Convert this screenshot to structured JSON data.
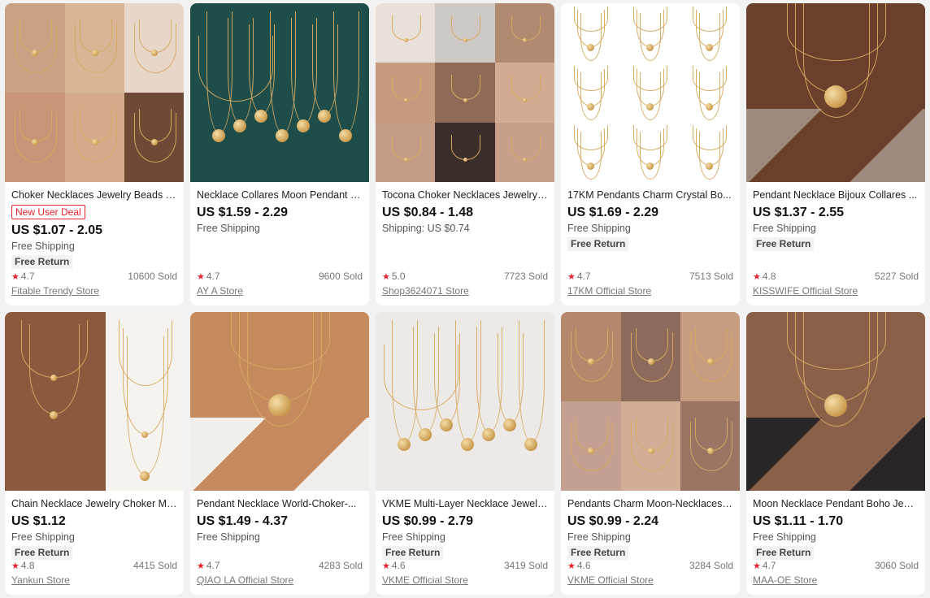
{
  "products": [
    {
      "title": "Choker Necklaces Jewelry Beads St...",
      "badge": "New User Deal",
      "price": "US $1.07 - 2.05",
      "shipping": "Free Shipping",
      "free_return": "Free Return",
      "rating": "4.7",
      "sold": "10600 Sold",
      "store": "Fitable Trendy Store"
    },
    {
      "title": "Necklace Collares Moon Pendant C...",
      "badge": "",
      "price": "US $1.59 - 2.29",
      "shipping": "Free Shipping",
      "free_return": "",
      "rating": "4.7",
      "sold": "9600 Sold",
      "store": "AY A Store"
    },
    {
      "title": "Tocona Choker Necklaces Jewelry ...",
      "badge": "",
      "price": "US $0.84 - 1.48",
      "shipping": "Shipping: US $0.74",
      "free_return": "",
      "rating": "5.0",
      "sold": "7723 Sold",
      "store": "Shop3624071 Store"
    },
    {
      "title": "17KM Pendants Charm Crystal Bo...",
      "badge": "",
      "price": "US $1.69 - 2.29",
      "shipping": "Free Shipping",
      "free_return": "Free Return",
      "rating": "4.7",
      "sold": "7513 Sold",
      "store": "17KM Official Store"
    },
    {
      "title": "Pendant Necklace Bijoux Collares ...",
      "badge": "",
      "price": "US $1.37 - 2.55",
      "shipping": "Free Shipping",
      "free_return": "Free Return",
      "rating": "4.8",
      "sold": "5227 Sold",
      "store": "KISSWIFE Official Store"
    },
    {
      "title": "Chain Necklace Jewelry Choker Mo...",
      "badge": "",
      "price": "US $1.12",
      "shipping": "Free Shipping",
      "free_return": "Free Return",
      "rating": "4.8",
      "sold": "4415 Sold",
      "store": "Yankun Store"
    },
    {
      "title": "Pendant Necklace World-Choker-...",
      "badge": "",
      "price": "US $1.49 - 4.37",
      "shipping": "Free Shipping",
      "free_return": "",
      "rating": "4.7",
      "sold": "4283 Sold",
      "store": "QIAO LA Official Store"
    },
    {
      "title": "VKME Multi-Layer Necklace Jewelle...",
      "badge": "",
      "price": "US $0.99 - 2.79",
      "shipping": "Free Shipping",
      "free_return": "Free Return",
      "rating": "4.6",
      "sold": "3419 Sold",
      "store": "VKME Official Store"
    },
    {
      "title": "Pendants Charm Moon-Necklaces ...",
      "badge": "",
      "price": "US $0.99 - 2.24",
      "shipping": "Free Shipping",
      "free_return": "Free Return",
      "rating": "4.6",
      "sold": "3284 Sold",
      "store": "VKME Official Store"
    },
    {
      "title": "Moon Necklace Pendant Boho Jew...",
      "badge": "",
      "price": "US $1.11 - 1.70",
      "shipping": "Free Shipping",
      "free_return": "Free Return",
      "rating": "4.7",
      "sold": "3060 Sold",
      "store": "MAA-OE Store"
    }
  ],
  "images": [
    {
      "kind": "collage6",
      "tones": [
        "#c9a184",
        "#d8b595",
        "#e8d6c8",
        "#c89578",
        "#d6ab8c",
        "#6e4a36"
      ]
    },
    {
      "kind": "flatlay",
      "tones": [
        "#1f4e4a"
      ]
    },
    {
      "kind": "collage9",
      "tones": [
        "#e9e0da",
        "#cfc9c6",
        "#b18a72",
        "#c59a7e",
        "#8e6a57",
        "#d2ac92",
        "#c49d86",
        "#3a2e2a",
        "#c6a08a"
      ]
    },
    {
      "kind": "product4x3",
      "tones": [
        "#ffffff"
      ]
    },
    {
      "kind": "model",
      "tones": [
        "#6a3f2b",
        "#9e8a7c"
      ]
    },
    {
      "kind": "split2",
      "tones": [
        "#8a5a3e",
        "#f6f3ef"
      ]
    },
    {
      "kind": "model",
      "tones": [
        "#c68a5f",
        "#f1efeb"
      ]
    },
    {
      "kind": "flatlay",
      "tones": [
        "#ece9e6"
      ]
    },
    {
      "kind": "collage6b",
      "tones": [
        "#b5876c",
        "#8d6b5a",
        "#c79d82",
        "#c3a08f",
        "#d2ae96",
        "#9a7563"
      ]
    },
    {
      "kind": "model",
      "tones": [
        "#8a6049",
        "#2a2526"
      ]
    }
  ],
  "colors": {
    "accent": "#e8222f",
    "price": "#111111",
    "background": "#f2f2f2"
  },
  "icons": {
    "rating": "star-icon"
  }
}
